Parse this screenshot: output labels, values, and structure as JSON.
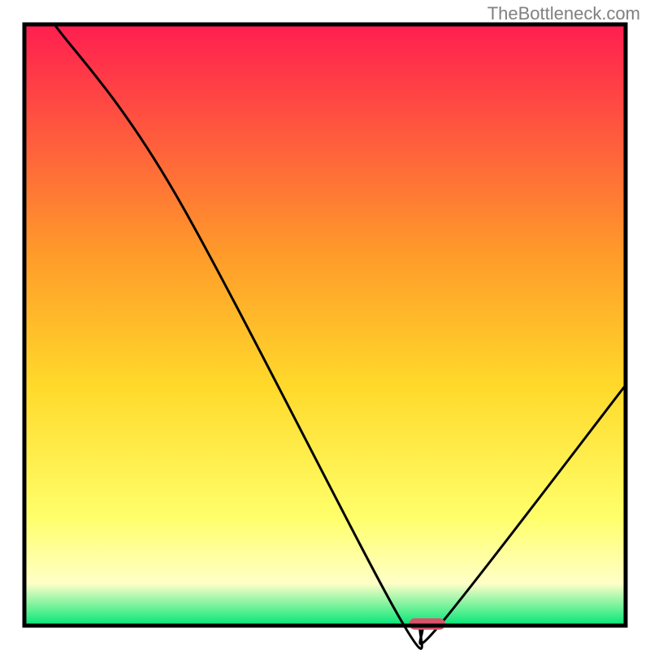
{
  "watermark": "TheBottleneck.com",
  "chart_data": {
    "type": "line",
    "title": "",
    "xlabel": "",
    "ylabel": "",
    "xlim": [
      0,
      100
    ],
    "ylim": [
      0,
      100
    ],
    "background_gradient": {
      "top": "#ff1e50",
      "mid_upper": "#ff9a2a",
      "mid": "#ffd92a",
      "mid_lower": "#ffff6a",
      "lower": "#ffffc8",
      "bottom": "#00e676"
    },
    "series": [
      {
        "name": "bottleneck-curve",
        "color": "#000000",
        "x": [
          5,
          25,
          62,
          66,
          69,
          100
        ],
        "y": [
          100,
          72,
          2,
          0,
          0,
          40
        ]
      }
    ],
    "marker": {
      "name": "optimal-range",
      "color": "#d9536b",
      "x_center": 67,
      "width": 6,
      "height": 2
    },
    "axes": {
      "frame_color": "#000000",
      "frame_width": 3
    }
  }
}
